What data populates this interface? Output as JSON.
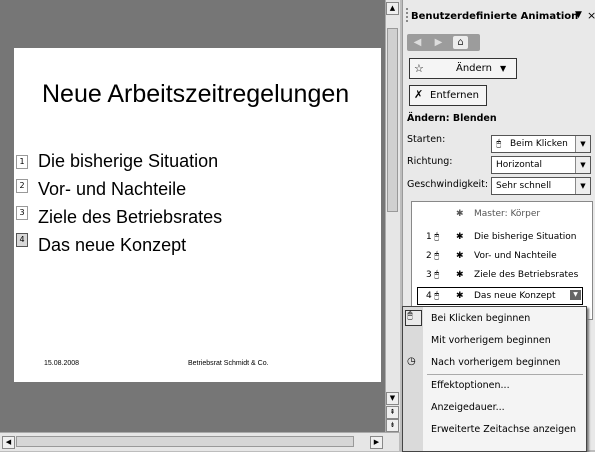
{
  "slide": {
    "title": "Neue Arbeitszeitregelungen",
    "bullets": [
      {
        "tag": "1",
        "text": "Die bisherige Situation"
      },
      {
        "tag": "2",
        "text": "Vor- und Nachteile"
      },
      {
        "tag": "3",
        "text": "Ziele des Betriebsrates"
      },
      {
        "tag": "4",
        "text": "Das neue Konzept"
      }
    ],
    "footer_date": "15.08.2008",
    "footer_text": "Betriebsrat Schmidt & Co."
  },
  "pane": {
    "title": "Benutzerdefinierte Animation",
    "title_arrow": "▼",
    "close": "×",
    "nav": [
      "◀",
      "▶",
      "⌂"
    ],
    "change_button": "Ändern",
    "remove_button": "Entfernen",
    "section_title": "Ändern: Blenden",
    "start_label": "Starten:",
    "start_value": "Beim Klicken",
    "direction_label": "Richtung:",
    "direction_value": "Horizontal",
    "speed_label": "Geschwindigkeit:",
    "speed_value": "Sehr schnell",
    "list_header": "Master: Körper",
    "items": [
      {
        "num": "1",
        "text": "Die bisherige Situation"
      },
      {
        "num": "2",
        "text": "Vor- und Nachteile"
      },
      {
        "num": "3",
        "text": "Ziele des Betriebsrates"
      },
      {
        "num": "4",
        "text": "Das neue Konzept"
      }
    ]
  },
  "menu": {
    "items": [
      "Bei Klicken beginnen",
      "Mit vorherigem beginnen",
      "Nach vorherigem beginnen",
      "Effektoptionen...",
      "Anzeigedauer...",
      "Erweiterte Zeitachse anzeigen"
    ]
  }
}
